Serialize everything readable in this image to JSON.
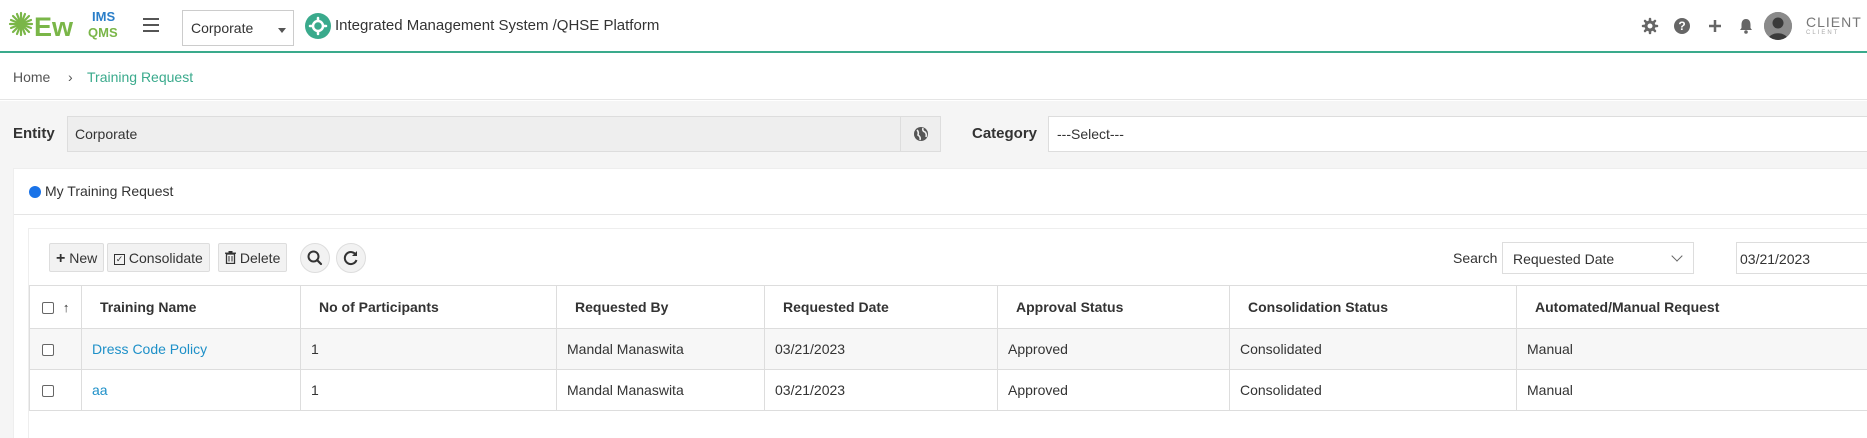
{
  "header": {
    "logo_main": "Ew",
    "logo_ims": "IMS",
    "logo_qms": "QMS",
    "entity_selected": "Corporate",
    "platform_title": "Integrated Management System /QHSE Platform",
    "client_name": "CLIENT L",
    "client_sub": "CLIENT",
    "icons": [
      "settings-icon",
      "help-icon",
      "plus-icon",
      "bell-icon",
      "avatar-icon"
    ]
  },
  "breadcrumb": {
    "home": "Home",
    "separator": "›",
    "current": "Training Request"
  },
  "filters": {
    "entity_label": "Entity",
    "entity_value": "Corporate",
    "category_label": "Category",
    "category_value": "---Select---"
  },
  "card": {
    "title": "My Training Request",
    "toolbar": {
      "new_label": "New",
      "consolidate_label": "Consolidate",
      "delete_label": "Delete",
      "search_label": "Search",
      "search_field": "Requested Date",
      "search_date": "03/21/2023"
    },
    "table": {
      "sort_indicator": "↑",
      "columns": [
        "Training Name",
        "No of Participants",
        "Requested By",
        "Requested Date",
        "Approval Status",
        "Consolidation Status",
        "Automated/Manual Request"
      ],
      "rows": [
        [
          "Dress Code Policy",
          "1",
          "Mandal Manaswita",
          "03/21/2023",
          "Approved",
          "Consolidated",
          "Manual"
        ],
        [
          "aa",
          "1",
          "Mandal Manaswita",
          "03/21/2023",
          "Approved",
          "Consolidated",
          "Manual"
        ]
      ]
    }
  },
  "colors": {
    "accent": "#3aaa8c",
    "link": "#1e90c8",
    "status_dot": "#1a73e8"
  }
}
